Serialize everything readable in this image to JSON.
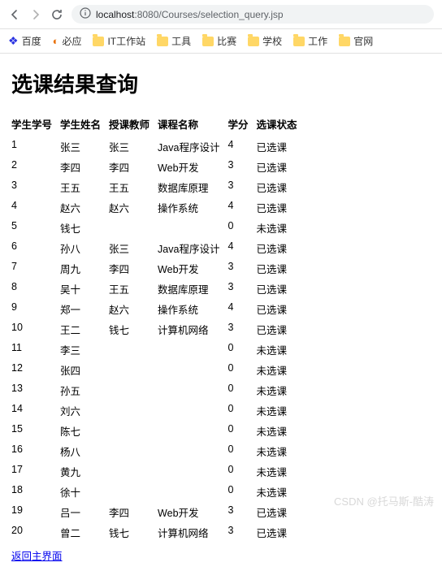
{
  "browser": {
    "url_prefix": "localhost",
    "url_port": ":8080",
    "url_path": "/Courses/selection_query.jsp",
    "bookmarks": [
      {
        "type": "baidu",
        "label": "百度"
      },
      {
        "type": "bing",
        "label": "必应"
      },
      {
        "type": "folder",
        "label": "IT工作站"
      },
      {
        "type": "folder",
        "label": "工具"
      },
      {
        "type": "folder",
        "label": "比赛"
      },
      {
        "type": "folder",
        "label": "学校"
      },
      {
        "type": "folder",
        "label": "工作"
      },
      {
        "type": "folder",
        "label": "官网"
      }
    ]
  },
  "page": {
    "title": "选课结果查询",
    "headers": {
      "id": "学生学号",
      "name": "学生姓名",
      "teacher": "授课教师",
      "course": "课程名称",
      "credit": "学分",
      "status": "选课状态"
    },
    "rows": [
      {
        "id": "1",
        "name": "张三",
        "teacher": "张三",
        "course": "Java程序设计",
        "credit": "4",
        "status": "已选课"
      },
      {
        "id": "2",
        "name": "李四",
        "teacher": "李四",
        "course": "Web开发",
        "credit": "3",
        "status": "已选课"
      },
      {
        "id": "3",
        "name": "王五",
        "teacher": "王五",
        "course": "数据库原理",
        "credit": "3",
        "status": "已选课"
      },
      {
        "id": "4",
        "name": "赵六",
        "teacher": "赵六",
        "course": "操作系统",
        "credit": "4",
        "status": "已选课"
      },
      {
        "id": "5",
        "name": "钱七",
        "teacher": "",
        "course": "",
        "credit": "0",
        "status": "未选课"
      },
      {
        "id": "6",
        "name": "孙八",
        "teacher": "张三",
        "course": "Java程序设计",
        "credit": "4",
        "status": "已选课"
      },
      {
        "id": "7",
        "name": "周九",
        "teacher": "李四",
        "course": "Web开发",
        "credit": "3",
        "status": "已选课"
      },
      {
        "id": "8",
        "name": "吴十",
        "teacher": "王五",
        "course": "数据库原理",
        "credit": "3",
        "status": "已选课"
      },
      {
        "id": "9",
        "name": "郑一",
        "teacher": "赵六",
        "course": "操作系统",
        "credit": "4",
        "status": "已选课"
      },
      {
        "id": "10",
        "name": "王二",
        "teacher": "钱七",
        "course": "计算机网络",
        "credit": "3",
        "status": "已选课"
      },
      {
        "id": "11",
        "name": "李三",
        "teacher": "",
        "course": "",
        "credit": "0",
        "status": "未选课"
      },
      {
        "id": "12",
        "name": "张四",
        "teacher": "",
        "course": "",
        "credit": "0",
        "status": "未选课"
      },
      {
        "id": "13",
        "name": "孙五",
        "teacher": "",
        "course": "",
        "credit": "0",
        "status": "未选课"
      },
      {
        "id": "14",
        "name": "刘六",
        "teacher": "",
        "course": "",
        "credit": "0",
        "status": "未选课"
      },
      {
        "id": "15",
        "name": "陈七",
        "teacher": "",
        "course": "",
        "credit": "0",
        "status": "未选课"
      },
      {
        "id": "16",
        "name": "杨八",
        "teacher": "",
        "course": "",
        "credit": "0",
        "status": "未选课"
      },
      {
        "id": "17",
        "name": "黄九",
        "teacher": "",
        "course": "",
        "credit": "0",
        "status": "未选课"
      },
      {
        "id": "18",
        "name": "徐十",
        "teacher": "",
        "course": "",
        "credit": "0",
        "status": "未选课"
      },
      {
        "id": "19",
        "name": "吕一",
        "teacher": "李四",
        "course": "Web开发",
        "credit": "3",
        "status": "已选课"
      },
      {
        "id": "20",
        "name": "曾二",
        "teacher": "钱七",
        "course": "计算机网络",
        "credit": "3",
        "status": "已选课"
      }
    ],
    "back_link": "返回主界面"
  },
  "watermark": "CSDN @托马斯-酷涛"
}
